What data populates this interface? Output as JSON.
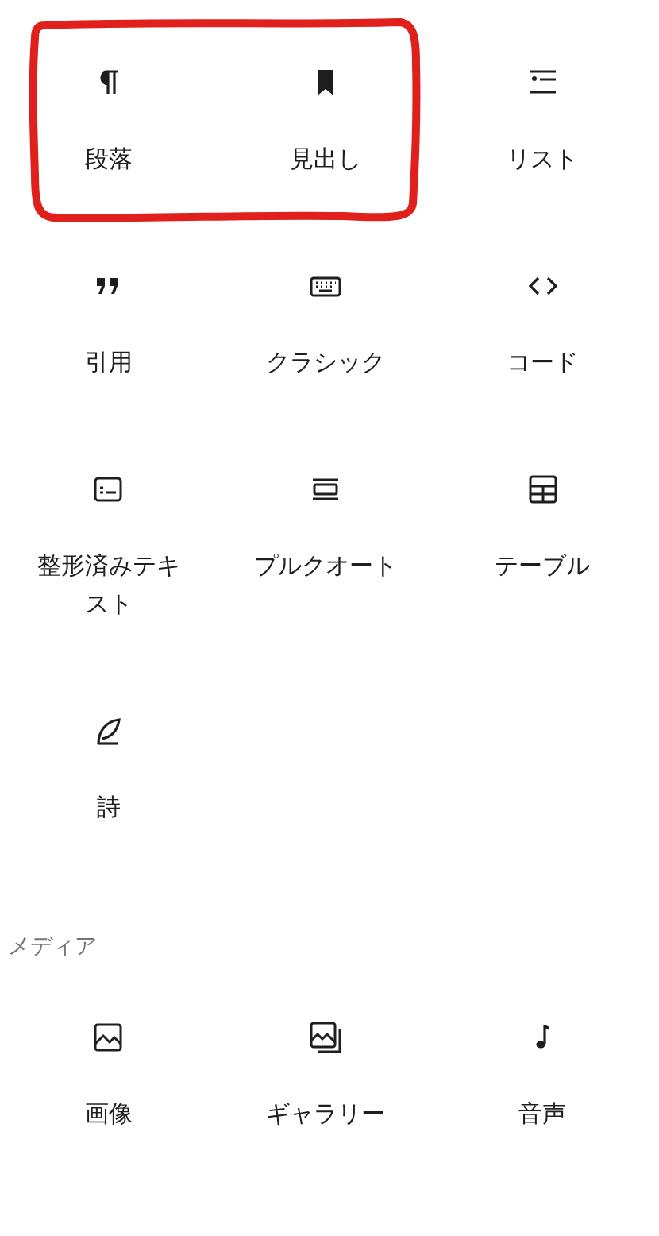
{
  "sections": [
    {
      "items": [
        {
          "kind": "paragraph",
          "label": "段落"
        },
        {
          "kind": "heading",
          "label": "見出し"
        },
        {
          "kind": "list",
          "label": "リスト"
        },
        {
          "kind": "quote",
          "label": "引用"
        },
        {
          "kind": "classic",
          "label": "クラシック"
        },
        {
          "kind": "code",
          "label": "コード"
        },
        {
          "kind": "preformatted",
          "label": "整形済みテキスト"
        },
        {
          "kind": "pullquote",
          "label": "プルクオート"
        },
        {
          "kind": "table",
          "label": "テーブル"
        },
        {
          "kind": "verse",
          "label": "詩"
        }
      ]
    },
    {
      "heading": "メディア",
      "items": [
        {
          "kind": "image",
          "label": "画像"
        },
        {
          "kind": "gallery",
          "label": "ギャラリー"
        },
        {
          "kind": "audio",
          "label": "音声"
        }
      ]
    }
  ]
}
